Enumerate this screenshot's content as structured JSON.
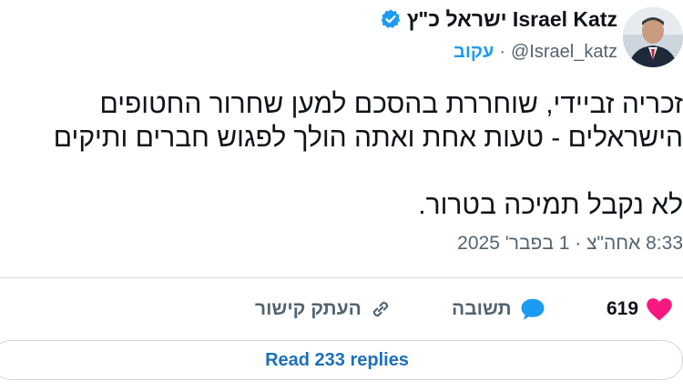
{
  "author": {
    "name": "ישראל כ\"ץ Israel Katz",
    "handle": "@Israel_katz",
    "follow_label": "עקוב",
    "separator": "·"
  },
  "tweet": {
    "lines": [
      "זכריה זביידי, שוחררת בהסכם למען שחרור החטופים",
      "הישראלים - טעות אחת ואתה הולך לפגוש חברים ותיקים",
      "לא נקבל תמיכה בטרור."
    ],
    "timestamp": "8:33 אחה\"צ · 1 בפבר' 2025"
  },
  "actions": {
    "like_count": "619",
    "reply_label": "תשובה",
    "copy_link_label": "העתק קישור"
  },
  "footer": {
    "read_replies_label": "Read 233 replies"
  },
  "colors": {
    "accent": "#1d9bf0",
    "like": "#f91880",
    "muted": "#536471"
  }
}
